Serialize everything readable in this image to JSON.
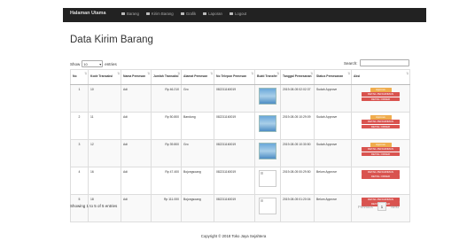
{
  "navbar": {
    "brand": "Halaman Utama",
    "items": [
      {
        "label": "Barang",
        "icon": "box-icon"
      },
      {
        "label": "Kirim Barang",
        "icon": "truck-icon"
      },
      {
        "label": "Grafik",
        "icon": "chart-icon"
      },
      {
        "label": "Laporan",
        "icon": "file-icon"
      },
      {
        "label": "Logout",
        "icon": "logout-icon"
      }
    ]
  },
  "page": {
    "title": "Data Kirim Barang"
  },
  "table_controls": {
    "show_label": "Show",
    "entries_value": "10",
    "entries_label": "entries",
    "search_label": "Search:"
  },
  "table": {
    "headers": [
      "No",
      "Kode Transaksi",
      "Nama Pemesan",
      "Jumlah Transaksi",
      "Alamat Pemesan",
      "No Telepon Pemesan",
      "Bukti Transfer",
      "Tanggal Pemesanan",
      "Status Pemesanan",
      "Aksi"
    ],
    "rows": [
      {
        "no": "1",
        "kode": "10",
        "nama": "Adi",
        "jumlah": "Rp 46.210",
        "alamat": "Gro",
        "telepon": "082211160019",
        "bukti": "image",
        "tanggal": "2019-08-05 02:02:37",
        "status": "Sudah Approve",
        "actions": [
          "Approve",
          "DETAIL PENGIRIMAN",
          "DETAIL ORDER"
        ]
      },
      {
        "no": "2",
        "kode": "11",
        "nama": "Adi",
        "jumlah": "Rp 50.800",
        "alamat": "Bandung",
        "telepon": "082211160019",
        "bukti": "image",
        "tanggal": "2019-08-05 10:29:09",
        "status": "Sudah Approve",
        "actions": [
          "Approve",
          "DETAIL PENGIRIMAN",
          "DETAIL ORDER"
        ]
      },
      {
        "no": "3",
        "kode": "12",
        "nama": "Adi",
        "jumlah": "Rp 39.800",
        "alamat": "Gro",
        "telepon": "082211160019",
        "bukti": "image",
        "tanggal": "2019-08-05 10:30:50",
        "status": "Sudah Approve",
        "actions": [
          "Approve",
          "DETAIL PENGIRIMAN",
          "DETAIL ORDER"
        ]
      },
      {
        "no": "4",
        "kode": "16",
        "nama": "Adi",
        "jumlah": "Rp 47.400",
        "alamat": "Bojongsoang",
        "telepon": "082211160019",
        "bukti": "broken",
        "tanggal": "2019-08-05 00:29:50",
        "status": "Belum Approve",
        "actions": [
          "DETAIL PENGIRIMAN",
          "DETAIL ORDER"
        ]
      },
      {
        "no": "5",
        "kode": "18",
        "nama": "Adi",
        "jumlah": "Rp 111.000",
        "alamat": "Bojongsoang",
        "telepon": "082211160019",
        "bukti": "broken",
        "tanggal": "2019-08-05 01:20:04",
        "status": "Belum Approve",
        "actions": [
          "DETAIL PENGIRIMAN",
          "DETAIL ORDER"
        ]
      }
    ]
  },
  "info": "Showing 1 to 5 of 5 entries",
  "pagination": {
    "prev": "Previous",
    "current": "1",
    "next": "Next"
  },
  "footer": "Copyright © 2018 Toko Jaya Sejahtera",
  "colors": {
    "navbar": "#222222",
    "approve": "#f0ad4e",
    "detail": "#d9534f"
  }
}
